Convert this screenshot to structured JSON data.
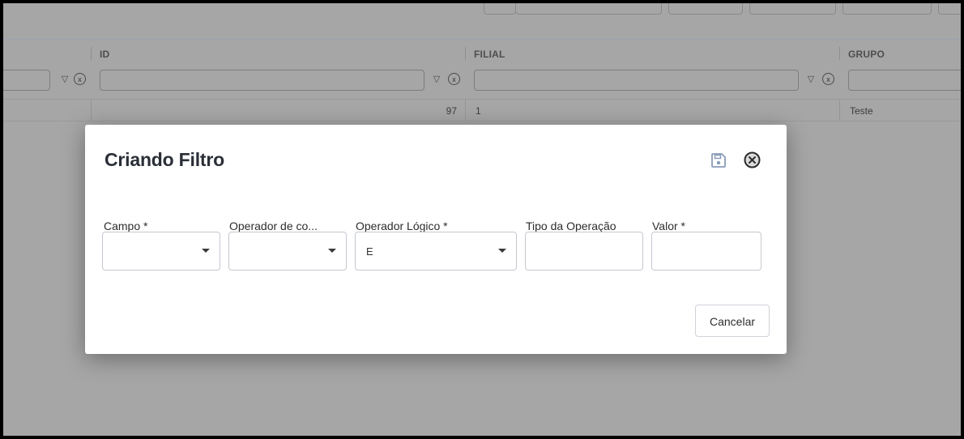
{
  "grid": {
    "columns": [
      {
        "title": "ID"
      },
      {
        "title": "FILIAL"
      },
      {
        "title": "GRUPO"
      }
    ],
    "row": {
      "id": "97",
      "filial": "1",
      "grupo": "Teste"
    },
    "filter_clear_glyph": "x"
  },
  "modal": {
    "title": "Criando Filtro",
    "fields": [
      {
        "label": "Campo *",
        "value": "",
        "type": "select"
      },
      {
        "label": "Operador de co...",
        "value": "",
        "type": "select"
      },
      {
        "label": "Operador Lógico *",
        "value": "E",
        "type": "select"
      },
      {
        "label": "Tipo da Operação",
        "value": "",
        "type": "input"
      },
      {
        "label": "Valor *",
        "value": "",
        "type": "input"
      }
    ],
    "cancel_label": "Cancelar"
  },
  "icons": {
    "save": "save-icon",
    "close": "close-circle-icon",
    "filter": "filter-funnel-icon"
  },
  "colors": {
    "overlay": "#a6a6a6",
    "title_text": "#2a2f37",
    "icon_blue_gray": "#8b9cb8"
  }
}
